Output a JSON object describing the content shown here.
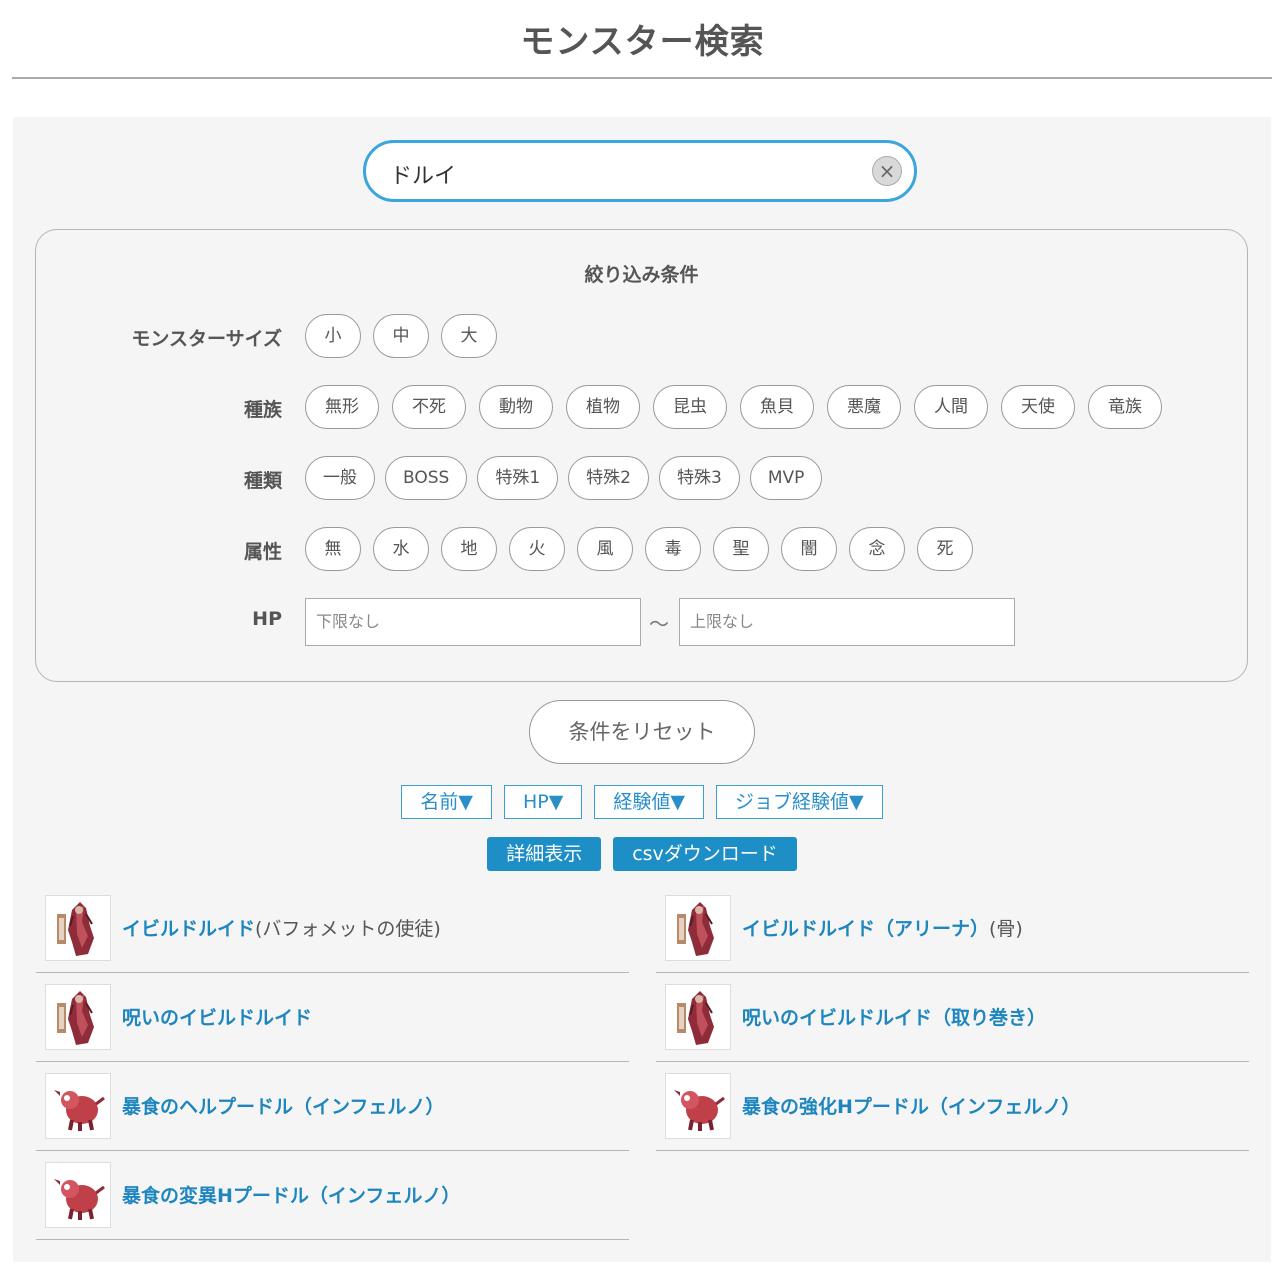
{
  "page": {
    "title": "モンスター検索"
  },
  "search": {
    "value": "ドルイ",
    "clear_icon": "×"
  },
  "filters": {
    "title": "絞り込み条件",
    "size": {
      "label": "モンスターサイズ",
      "options": [
        "小",
        "中",
        "大"
      ]
    },
    "race": {
      "label": "種族",
      "options": [
        "無形",
        "不死",
        "動物",
        "植物",
        "昆虫",
        "魚貝",
        "悪魔",
        "人間",
        "天使",
        "竜族"
      ]
    },
    "type": {
      "label": "種類",
      "options": [
        "一般",
        "BOSS",
        "特殊1",
        "特殊2",
        "特殊3",
        "MVP"
      ]
    },
    "element": {
      "label": "属性",
      "options": [
        "無",
        "水",
        "地",
        "火",
        "風",
        "毒",
        "聖",
        "闇",
        "念",
        "死"
      ]
    },
    "hp": {
      "label": "HP",
      "min_placeholder": "下限なし",
      "max_placeholder": "上限なし",
      "separator": "〜"
    }
  },
  "reset_label": "条件をリセット",
  "sort": [
    "名前▼",
    "HP▼",
    "経験値▼",
    "ジョブ経験値▼"
  ],
  "actions": [
    "詳細表示",
    "csvダウンロード"
  ],
  "results": [
    {
      "name": "イビルドルイド",
      "suffix": "(バフォメットの使徒)",
      "icon": "evil-druid-icon"
    },
    {
      "name": "イビルドルイド（アリーナ）",
      "suffix": "(骨)",
      "icon": "evil-druid-icon"
    },
    {
      "name": "呪いのイビルドルイド",
      "suffix": "",
      "icon": "evil-druid-icon"
    },
    {
      "name": "呪いのイビルドルイド（取り巻き）",
      "suffix": "",
      "icon": "evil-druid-icon"
    },
    {
      "name": "暴食のヘルプードル（インフェルノ）",
      "suffix": "",
      "icon": "hell-poodle-icon"
    },
    {
      "name": "暴食の強化Hプードル（インフェルノ）",
      "suffix": "",
      "icon": "hell-poodle-icon"
    },
    {
      "name": "暴食の変異Hプードル（インフェルノ）",
      "suffix": "",
      "icon": "hell-poodle-icon"
    }
  ]
}
